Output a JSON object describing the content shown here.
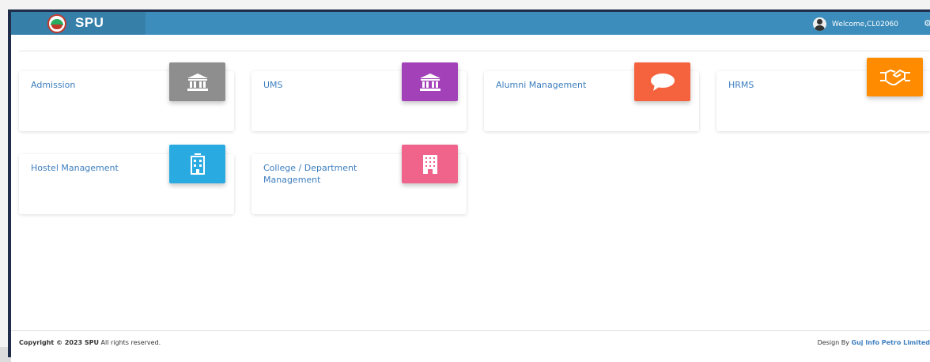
{
  "header": {
    "brand": "SPU",
    "welcome": "Welcome,CL02060"
  },
  "modules": [
    {
      "label": "Admission",
      "icon": "bank-icon",
      "color": "#8e8e8e"
    },
    {
      "label": "UMS",
      "icon": "bank-icon",
      "color": "#a341b9"
    },
    {
      "label": "Alumni Management",
      "icon": "chat-bubble-icon",
      "color": "#f5623e"
    },
    {
      "label": "HRMS",
      "icon": "handshake-icon",
      "color": "#ff8c00"
    },
    {
      "label": "Hostel Management",
      "icon": "building-icon",
      "color": "#29abe2"
    },
    {
      "label": "College / Department Management",
      "icon": "office-building-icon",
      "color": "#f0648c"
    }
  ],
  "footer": {
    "copyright_prefix": "Copyright © 2023 SPU",
    "copyright_suffix": " All rights reserved.",
    "design_prefix": "Design By ",
    "design_company": "Guj Info Petro Limited"
  }
}
